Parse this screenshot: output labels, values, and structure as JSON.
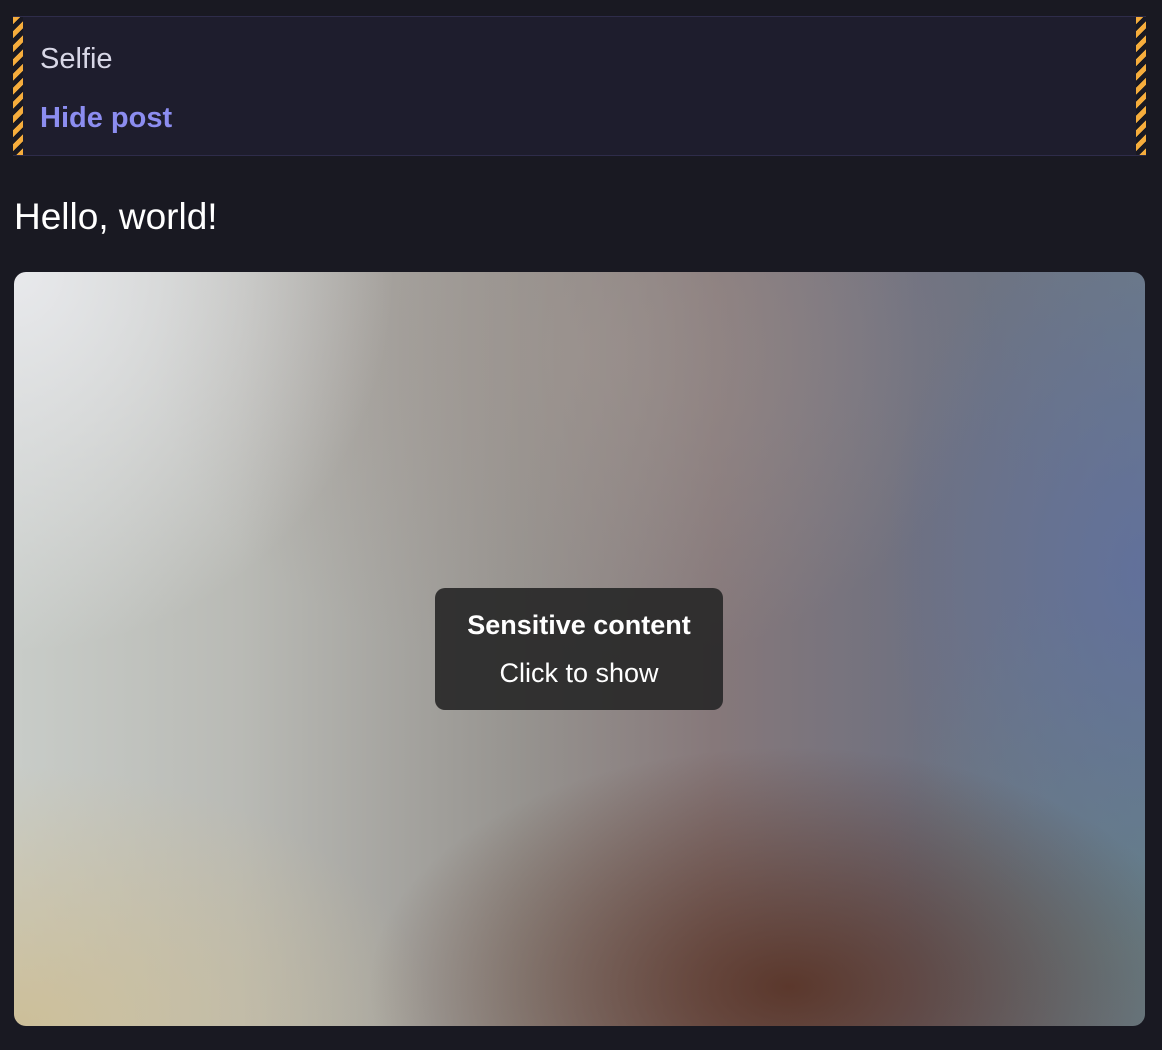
{
  "content_warning": {
    "text": "Selfie",
    "toggle_label": "Hide post"
  },
  "status": {
    "text": "Hello, world!"
  },
  "media": {
    "sensitive_title": "Sensitive content",
    "sensitive_hint": "Click to show"
  },
  "colors": {
    "background": "#191922",
    "link": "#8c8df0",
    "warning_stripe": "#f6ad3c"
  }
}
